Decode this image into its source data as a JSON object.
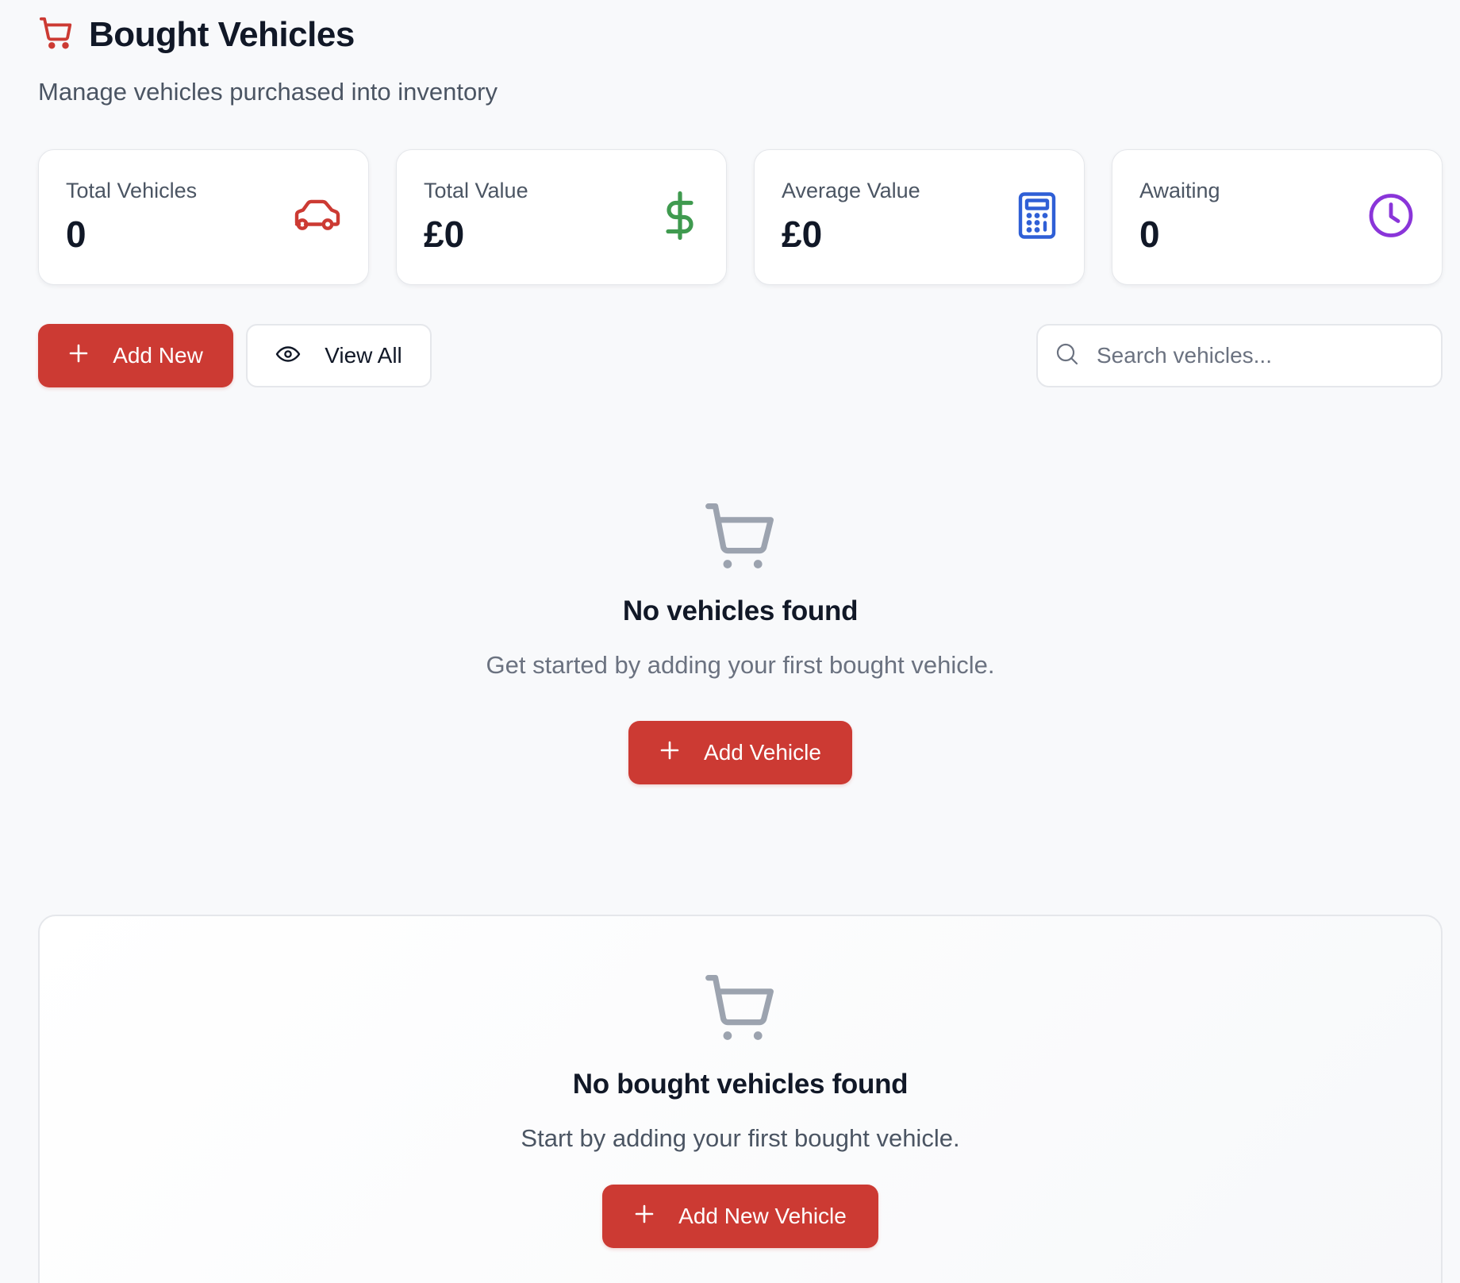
{
  "header": {
    "title": "Bought Vehicles",
    "subtitle": "Manage vehicles purchased into inventory",
    "icon": "shopping-cart-icon"
  },
  "stats": [
    {
      "label": "Total Vehicles",
      "value": "0",
      "icon": "car-icon",
      "color": "#cc3a33"
    },
    {
      "label": "Total Value",
      "value": "£0",
      "icon": "dollar-icon",
      "color": "#3f9a4f"
    },
    {
      "label": "Average Value",
      "value": "£0",
      "icon": "calculator-icon",
      "color": "#2f5fd6"
    },
    {
      "label": "Awaiting",
      "value": "0",
      "icon": "clock-icon",
      "color": "#8a35d9"
    }
  ],
  "toolbar": {
    "add_new_label": "Add New",
    "view_all_label": "View All",
    "search_placeholder": "Search vehicles..."
  },
  "empty_state": {
    "title": "No vehicles found",
    "description": "Get started by adding your first bought vehicle.",
    "button_label": "Add Vehicle"
  },
  "empty_card": {
    "title": "No bought vehicles found",
    "description": "Start by adding your first bought vehicle.",
    "button_label": "Add New Vehicle"
  },
  "colors": {
    "accent": "#cc3a33",
    "muted_icon": "#9ca3af",
    "background": "#f8f9fb"
  }
}
